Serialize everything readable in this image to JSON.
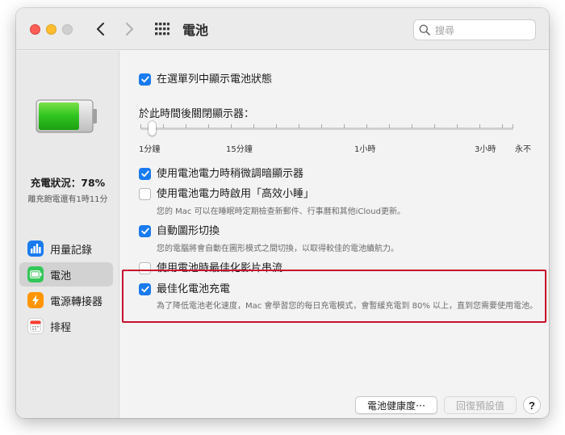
{
  "window": {
    "title": "電池",
    "search_placeholder": "搜尋"
  },
  "sidebar": {
    "charge_status": "充電狀況：78%",
    "charge_sub": "離充飽電還有1時11分",
    "battery_level_percent": 78,
    "items": [
      {
        "label": "用量記錄",
        "icon": "bar-chart-icon",
        "color": "#1a7bf0",
        "selected": false
      },
      {
        "label": "電池",
        "icon": "battery-icon",
        "color": "#34c759",
        "selected": true
      },
      {
        "label": "電源轉接器",
        "icon": "lightning-icon",
        "color": "#ff9500",
        "selected": false
      },
      {
        "label": "排程",
        "icon": "calendar-icon",
        "color": "#ff3b30",
        "selected": false
      }
    ]
  },
  "content": {
    "show_status": {
      "label": "在選單列中顯示電池狀態",
      "checked": true
    },
    "slider": {
      "title": "於此時間後關閉顯示器：",
      "labels": [
        "1分鐘",
        "15分鐘",
        "1小時",
        "3小時",
        "永不"
      ],
      "value": "1分鐘"
    },
    "dim_display": {
      "label": "使用電池電力時稍微調暗顯示器",
      "checked": true
    },
    "power_nap": {
      "label": "使用電池電力時啟用「高效小睡」",
      "checked": false,
      "desc": "您的 Mac 可以在睡眠時定期檢查新郵件、行事曆和其他iCloud更新。"
    },
    "graphics_switch": {
      "label": "自動圖形切換",
      "checked": true,
      "desc": "您的電腦將會自動在圖形模式之間切換，以取得較佳的電池續航力。"
    },
    "optimize_video": {
      "label": "使用電池時最佳化影片串流",
      "checked": false
    },
    "optimized_charging": {
      "label": "最佳化電池充電",
      "checked": true,
      "desc": "為了降低電池老化速度，Mac 會學習您的每日充電模式，會暫緩充電到 80% 以上，直到您需要使用電池。"
    },
    "buttons": {
      "battery_health": "電池健康度⋯",
      "restore_defaults": "回復預設值",
      "help": "?"
    }
  }
}
